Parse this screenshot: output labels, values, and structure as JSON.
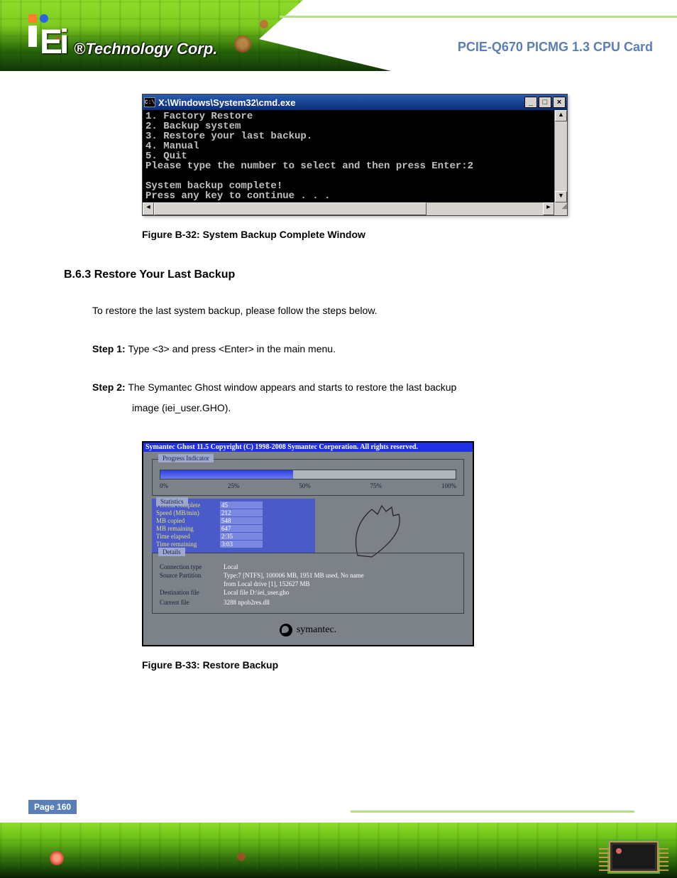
{
  "header": {
    "logo_r": "®",
    "logo_text": "Technology Corp.",
    "product": "PCIE-Q670 PICMG 1.3 CPU Card"
  },
  "cmd": {
    "title_icon": "C:\\",
    "title": "X:\\Windows\\System32\\cmd.exe",
    "body": "1. Factory Restore\n2. Backup system\n3. Restore your last backup.\n4. Manual\n5. Quit\nPlease type the number to select and then press Enter:2\n\nSystem backup complete!\nPress any key to continue . . ."
  },
  "captionA": "Figure B-32: System Backup Complete Window",
  "section_title": "B.6.3 Restore Your Last Backup",
  "para1": "To restore the last system backup, please follow the steps below.",
  "step1_label": "Step 1:",
  "step1_text": " Type <3> and press <Enter> in the main menu.",
  "step2_label": "Step 2:",
  "step2_text": " The Symantec Ghost window appears and starts to restore the last backup",
  "step2_cont": "image (iei_user.GHO).",
  "ghost": {
    "title": "Symantec Ghost 11.5    Copyright (C) 1998-2008 Symantec Corporation. All rights reserved.",
    "progress_label": "Progress Indicator",
    "ticks": [
      "0%",
      "25%",
      "50%",
      "75%",
      "100%"
    ],
    "stats_label": "Statistics",
    "stats": [
      {
        "k": "Percent complete",
        "v": "45"
      },
      {
        "k": "Speed (MB/min)",
        "v": "212"
      },
      {
        "k": "MB copied",
        "v": "548"
      },
      {
        "k": "MB remaining",
        "v": "647"
      },
      {
        "k": "Time elapsed",
        "v": "2:35"
      },
      {
        "k": "Time remaining",
        "v": "3:03"
      }
    ],
    "details_label": "Details",
    "details": [
      {
        "k": "Connection type",
        "v": "Local"
      },
      {
        "k": "Source Partition",
        "v": "Type:7 [NTFS], 100006 MB, 1951 MB used, No name"
      },
      {
        "k": "",
        "v": "from Local drive [1], 152627 MB"
      },
      {
        "k": "Destination file",
        "v": "Local file D:\\iei_user.gho"
      },
      {
        "k": "",
        "v": ""
      },
      {
        "k": "Current file",
        "v": "3288 npob2res.dll"
      }
    ],
    "brand": "symantec."
  },
  "captionB": "Figure B-33: Restore Backup",
  "footer": {
    "page": "Page 160"
  }
}
